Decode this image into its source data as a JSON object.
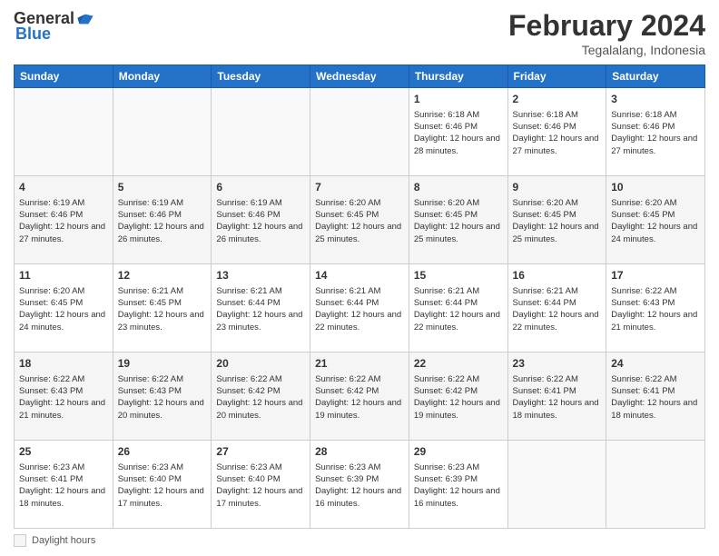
{
  "header": {
    "logo_general": "General",
    "logo_blue": "Blue",
    "month_title": "February 2024",
    "location": "Tegalalang, Indonesia"
  },
  "weekdays": [
    "Sunday",
    "Monday",
    "Tuesday",
    "Wednesday",
    "Thursday",
    "Friday",
    "Saturday"
  ],
  "footer": {
    "label": "Daylight hours"
  },
  "weeks": [
    [
      {
        "day": "",
        "sunrise": "",
        "sunset": "",
        "daylight": "",
        "empty": true
      },
      {
        "day": "",
        "sunrise": "",
        "sunset": "",
        "daylight": "",
        "empty": true
      },
      {
        "day": "",
        "sunrise": "",
        "sunset": "",
        "daylight": "",
        "empty": true
      },
      {
        "day": "",
        "sunrise": "",
        "sunset": "",
        "daylight": "",
        "empty": true
      },
      {
        "day": "1",
        "sunrise": "Sunrise: 6:18 AM",
        "sunset": "Sunset: 6:46 PM",
        "daylight": "Daylight: 12 hours and 28 minutes.",
        "empty": false
      },
      {
        "day": "2",
        "sunrise": "Sunrise: 6:18 AM",
        "sunset": "Sunset: 6:46 PM",
        "daylight": "Daylight: 12 hours and 27 minutes.",
        "empty": false
      },
      {
        "day": "3",
        "sunrise": "Sunrise: 6:18 AM",
        "sunset": "Sunset: 6:46 PM",
        "daylight": "Daylight: 12 hours and 27 minutes.",
        "empty": false
      }
    ],
    [
      {
        "day": "4",
        "sunrise": "Sunrise: 6:19 AM",
        "sunset": "Sunset: 6:46 PM",
        "daylight": "Daylight: 12 hours and 27 minutes.",
        "empty": false
      },
      {
        "day": "5",
        "sunrise": "Sunrise: 6:19 AM",
        "sunset": "Sunset: 6:46 PM",
        "daylight": "Daylight: 12 hours and 26 minutes.",
        "empty": false
      },
      {
        "day": "6",
        "sunrise": "Sunrise: 6:19 AM",
        "sunset": "Sunset: 6:46 PM",
        "daylight": "Daylight: 12 hours and 26 minutes.",
        "empty": false
      },
      {
        "day": "7",
        "sunrise": "Sunrise: 6:20 AM",
        "sunset": "Sunset: 6:45 PM",
        "daylight": "Daylight: 12 hours and 25 minutes.",
        "empty": false
      },
      {
        "day": "8",
        "sunrise": "Sunrise: 6:20 AM",
        "sunset": "Sunset: 6:45 PM",
        "daylight": "Daylight: 12 hours and 25 minutes.",
        "empty": false
      },
      {
        "day": "9",
        "sunrise": "Sunrise: 6:20 AM",
        "sunset": "Sunset: 6:45 PM",
        "daylight": "Daylight: 12 hours and 25 minutes.",
        "empty": false
      },
      {
        "day": "10",
        "sunrise": "Sunrise: 6:20 AM",
        "sunset": "Sunset: 6:45 PM",
        "daylight": "Daylight: 12 hours and 24 minutes.",
        "empty": false
      }
    ],
    [
      {
        "day": "11",
        "sunrise": "Sunrise: 6:20 AM",
        "sunset": "Sunset: 6:45 PM",
        "daylight": "Daylight: 12 hours and 24 minutes.",
        "empty": false
      },
      {
        "day": "12",
        "sunrise": "Sunrise: 6:21 AM",
        "sunset": "Sunset: 6:45 PM",
        "daylight": "Daylight: 12 hours and 23 minutes.",
        "empty": false
      },
      {
        "day": "13",
        "sunrise": "Sunrise: 6:21 AM",
        "sunset": "Sunset: 6:44 PM",
        "daylight": "Daylight: 12 hours and 23 minutes.",
        "empty": false
      },
      {
        "day": "14",
        "sunrise": "Sunrise: 6:21 AM",
        "sunset": "Sunset: 6:44 PM",
        "daylight": "Daylight: 12 hours and 22 minutes.",
        "empty": false
      },
      {
        "day": "15",
        "sunrise": "Sunrise: 6:21 AM",
        "sunset": "Sunset: 6:44 PM",
        "daylight": "Daylight: 12 hours and 22 minutes.",
        "empty": false
      },
      {
        "day": "16",
        "sunrise": "Sunrise: 6:21 AM",
        "sunset": "Sunset: 6:44 PM",
        "daylight": "Daylight: 12 hours and 22 minutes.",
        "empty": false
      },
      {
        "day": "17",
        "sunrise": "Sunrise: 6:22 AM",
        "sunset": "Sunset: 6:43 PM",
        "daylight": "Daylight: 12 hours and 21 minutes.",
        "empty": false
      }
    ],
    [
      {
        "day": "18",
        "sunrise": "Sunrise: 6:22 AM",
        "sunset": "Sunset: 6:43 PM",
        "daylight": "Daylight: 12 hours and 21 minutes.",
        "empty": false
      },
      {
        "day": "19",
        "sunrise": "Sunrise: 6:22 AM",
        "sunset": "Sunset: 6:43 PM",
        "daylight": "Daylight: 12 hours and 20 minutes.",
        "empty": false
      },
      {
        "day": "20",
        "sunrise": "Sunrise: 6:22 AM",
        "sunset": "Sunset: 6:42 PM",
        "daylight": "Daylight: 12 hours and 20 minutes.",
        "empty": false
      },
      {
        "day": "21",
        "sunrise": "Sunrise: 6:22 AM",
        "sunset": "Sunset: 6:42 PM",
        "daylight": "Daylight: 12 hours and 19 minutes.",
        "empty": false
      },
      {
        "day": "22",
        "sunrise": "Sunrise: 6:22 AM",
        "sunset": "Sunset: 6:42 PM",
        "daylight": "Daylight: 12 hours and 19 minutes.",
        "empty": false
      },
      {
        "day": "23",
        "sunrise": "Sunrise: 6:22 AM",
        "sunset": "Sunset: 6:41 PM",
        "daylight": "Daylight: 12 hours and 18 minutes.",
        "empty": false
      },
      {
        "day": "24",
        "sunrise": "Sunrise: 6:22 AM",
        "sunset": "Sunset: 6:41 PM",
        "daylight": "Daylight: 12 hours and 18 minutes.",
        "empty": false
      }
    ],
    [
      {
        "day": "25",
        "sunrise": "Sunrise: 6:23 AM",
        "sunset": "Sunset: 6:41 PM",
        "daylight": "Daylight: 12 hours and 18 minutes.",
        "empty": false
      },
      {
        "day": "26",
        "sunrise": "Sunrise: 6:23 AM",
        "sunset": "Sunset: 6:40 PM",
        "daylight": "Daylight: 12 hours and 17 minutes.",
        "empty": false
      },
      {
        "day": "27",
        "sunrise": "Sunrise: 6:23 AM",
        "sunset": "Sunset: 6:40 PM",
        "daylight": "Daylight: 12 hours and 17 minutes.",
        "empty": false
      },
      {
        "day": "28",
        "sunrise": "Sunrise: 6:23 AM",
        "sunset": "Sunset: 6:39 PM",
        "daylight": "Daylight: 12 hours and 16 minutes.",
        "empty": false
      },
      {
        "day": "29",
        "sunrise": "Sunrise: 6:23 AM",
        "sunset": "Sunset: 6:39 PM",
        "daylight": "Daylight: 12 hours and 16 minutes.",
        "empty": false
      },
      {
        "day": "",
        "sunrise": "",
        "sunset": "",
        "daylight": "",
        "empty": true
      },
      {
        "day": "",
        "sunrise": "",
        "sunset": "",
        "daylight": "",
        "empty": true
      }
    ]
  ]
}
